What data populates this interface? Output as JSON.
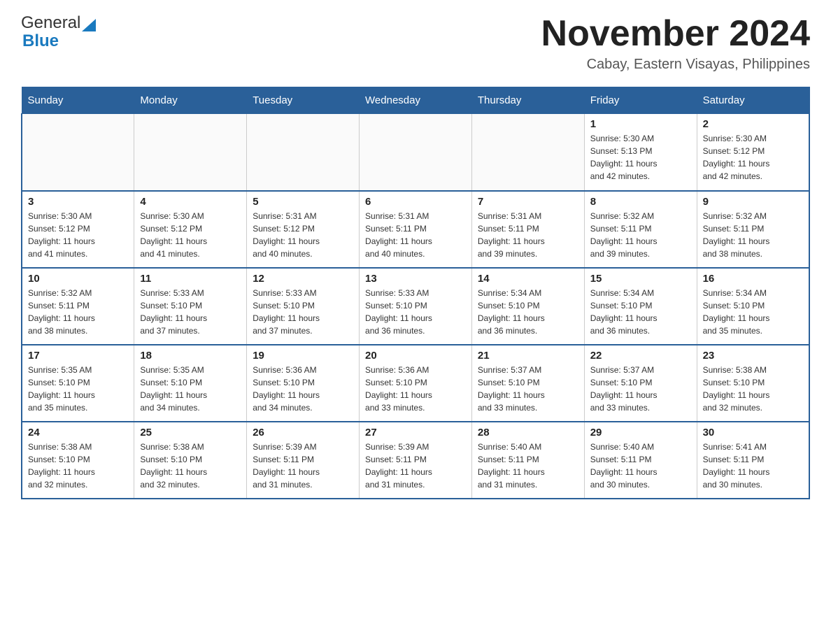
{
  "logo": {
    "general": "General",
    "blue": "Blue",
    "tagline": ""
  },
  "header": {
    "title": "November 2024",
    "subtitle": "Cabay, Eastern Visayas, Philippines"
  },
  "days_of_week": [
    "Sunday",
    "Monday",
    "Tuesday",
    "Wednesday",
    "Thursday",
    "Friday",
    "Saturday"
  ],
  "weeks": [
    [
      {
        "day": "",
        "info": ""
      },
      {
        "day": "",
        "info": ""
      },
      {
        "day": "",
        "info": ""
      },
      {
        "day": "",
        "info": ""
      },
      {
        "day": "",
        "info": ""
      },
      {
        "day": "1",
        "info": "Sunrise: 5:30 AM\nSunset: 5:13 PM\nDaylight: 11 hours\nand 42 minutes."
      },
      {
        "day": "2",
        "info": "Sunrise: 5:30 AM\nSunset: 5:12 PM\nDaylight: 11 hours\nand 42 minutes."
      }
    ],
    [
      {
        "day": "3",
        "info": "Sunrise: 5:30 AM\nSunset: 5:12 PM\nDaylight: 11 hours\nand 41 minutes."
      },
      {
        "day": "4",
        "info": "Sunrise: 5:30 AM\nSunset: 5:12 PM\nDaylight: 11 hours\nand 41 minutes."
      },
      {
        "day": "5",
        "info": "Sunrise: 5:31 AM\nSunset: 5:12 PM\nDaylight: 11 hours\nand 40 minutes."
      },
      {
        "day": "6",
        "info": "Sunrise: 5:31 AM\nSunset: 5:11 PM\nDaylight: 11 hours\nand 40 minutes."
      },
      {
        "day": "7",
        "info": "Sunrise: 5:31 AM\nSunset: 5:11 PM\nDaylight: 11 hours\nand 39 minutes."
      },
      {
        "day": "8",
        "info": "Sunrise: 5:32 AM\nSunset: 5:11 PM\nDaylight: 11 hours\nand 39 minutes."
      },
      {
        "day": "9",
        "info": "Sunrise: 5:32 AM\nSunset: 5:11 PM\nDaylight: 11 hours\nand 38 minutes."
      }
    ],
    [
      {
        "day": "10",
        "info": "Sunrise: 5:32 AM\nSunset: 5:11 PM\nDaylight: 11 hours\nand 38 minutes."
      },
      {
        "day": "11",
        "info": "Sunrise: 5:33 AM\nSunset: 5:10 PM\nDaylight: 11 hours\nand 37 minutes."
      },
      {
        "day": "12",
        "info": "Sunrise: 5:33 AM\nSunset: 5:10 PM\nDaylight: 11 hours\nand 37 minutes."
      },
      {
        "day": "13",
        "info": "Sunrise: 5:33 AM\nSunset: 5:10 PM\nDaylight: 11 hours\nand 36 minutes."
      },
      {
        "day": "14",
        "info": "Sunrise: 5:34 AM\nSunset: 5:10 PM\nDaylight: 11 hours\nand 36 minutes."
      },
      {
        "day": "15",
        "info": "Sunrise: 5:34 AM\nSunset: 5:10 PM\nDaylight: 11 hours\nand 36 minutes."
      },
      {
        "day": "16",
        "info": "Sunrise: 5:34 AM\nSunset: 5:10 PM\nDaylight: 11 hours\nand 35 minutes."
      }
    ],
    [
      {
        "day": "17",
        "info": "Sunrise: 5:35 AM\nSunset: 5:10 PM\nDaylight: 11 hours\nand 35 minutes."
      },
      {
        "day": "18",
        "info": "Sunrise: 5:35 AM\nSunset: 5:10 PM\nDaylight: 11 hours\nand 34 minutes."
      },
      {
        "day": "19",
        "info": "Sunrise: 5:36 AM\nSunset: 5:10 PM\nDaylight: 11 hours\nand 34 minutes."
      },
      {
        "day": "20",
        "info": "Sunrise: 5:36 AM\nSunset: 5:10 PM\nDaylight: 11 hours\nand 33 minutes."
      },
      {
        "day": "21",
        "info": "Sunrise: 5:37 AM\nSunset: 5:10 PM\nDaylight: 11 hours\nand 33 minutes."
      },
      {
        "day": "22",
        "info": "Sunrise: 5:37 AM\nSunset: 5:10 PM\nDaylight: 11 hours\nand 33 minutes."
      },
      {
        "day": "23",
        "info": "Sunrise: 5:38 AM\nSunset: 5:10 PM\nDaylight: 11 hours\nand 32 minutes."
      }
    ],
    [
      {
        "day": "24",
        "info": "Sunrise: 5:38 AM\nSunset: 5:10 PM\nDaylight: 11 hours\nand 32 minutes."
      },
      {
        "day": "25",
        "info": "Sunrise: 5:38 AM\nSunset: 5:10 PM\nDaylight: 11 hours\nand 32 minutes."
      },
      {
        "day": "26",
        "info": "Sunrise: 5:39 AM\nSunset: 5:11 PM\nDaylight: 11 hours\nand 31 minutes."
      },
      {
        "day": "27",
        "info": "Sunrise: 5:39 AM\nSunset: 5:11 PM\nDaylight: 11 hours\nand 31 minutes."
      },
      {
        "day": "28",
        "info": "Sunrise: 5:40 AM\nSunset: 5:11 PM\nDaylight: 11 hours\nand 31 minutes."
      },
      {
        "day": "29",
        "info": "Sunrise: 5:40 AM\nSunset: 5:11 PM\nDaylight: 11 hours\nand 30 minutes."
      },
      {
        "day": "30",
        "info": "Sunrise: 5:41 AM\nSunset: 5:11 PM\nDaylight: 11 hours\nand 30 minutes."
      }
    ]
  ]
}
